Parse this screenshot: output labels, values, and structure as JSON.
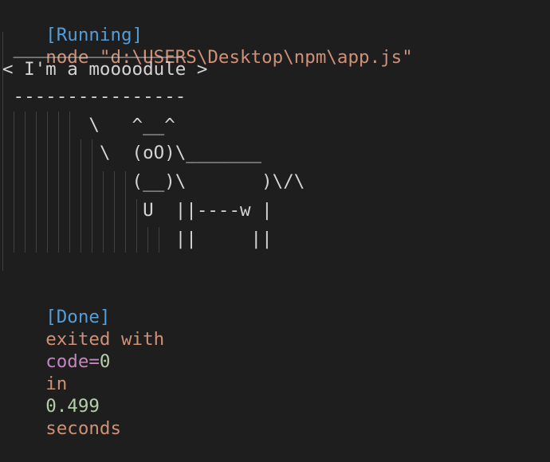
{
  "header": {
    "status": "[Running]",
    "command": "node \"d:\\USERS\\Desktop\\npm\\app.js\""
  },
  "output_lines": [
    " ________________",
    "< I'm a moooodule >",
    " ----------------",
    "        \\   ^__^",
    "         \\  (oO)\\_______",
    "            (__)\\       )\\/\\",
    "             U  ||----w |",
    "                ||     ||"
  ],
  "footer": {
    "status": "[Done]",
    "text1": "exited with",
    "code_label": "code=",
    "code_value": "0",
    "text2": "in",
    "duration": "0.499",
    "text3": "seconds"
  },
  "colors": {
    "background": "#1e1e1e",
    "bracket_status": "#569cd6",
    "string_text": "#ce9178",
    "keyword": "#c586c0",
    "number": "#b5cea8",
    "foreground": "#d4d4d4"
  }
}
